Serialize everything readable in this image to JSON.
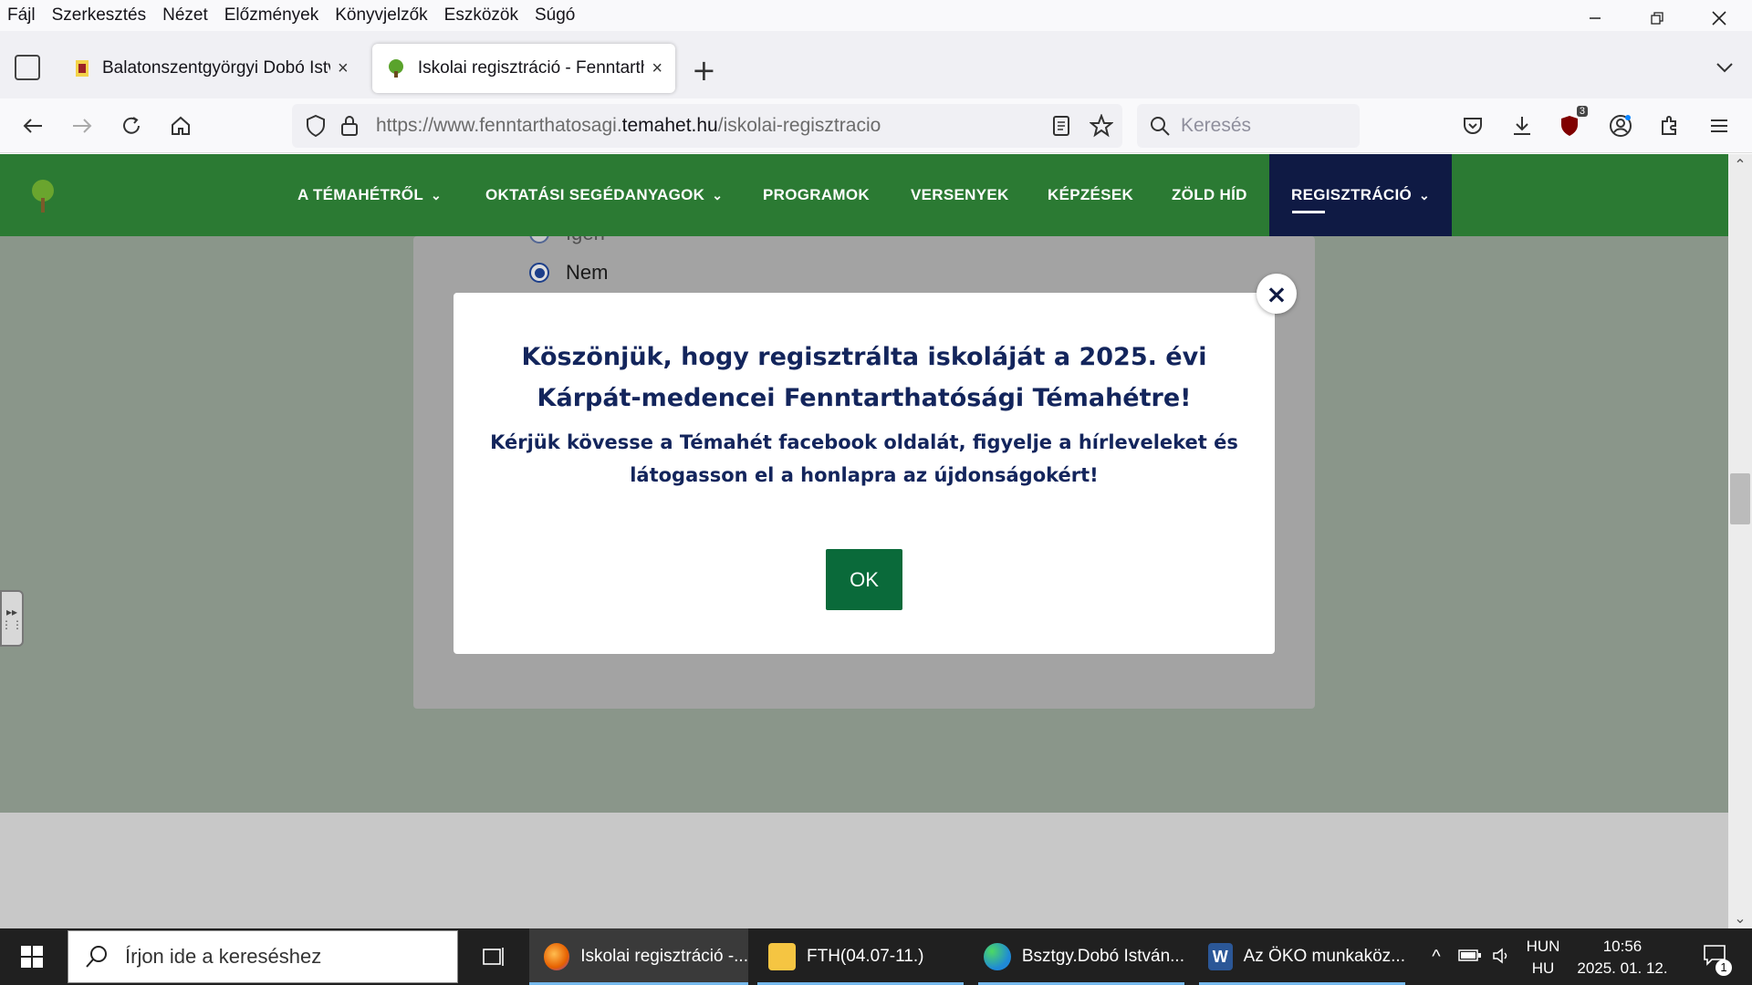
{
  "menu": [
    "Fájl",
    "Szerkesztés",
    "Nézet",
    "Előzmények",
    "Könyvjelzők",
    "Eszközök",
    "Súgó"
  ],
  "tabs": [
    {
      "title": "Balatonszentgyörgyi Dobó Istvá",
      "close": "×"
    },
    {
      "title": "Iskolai regisztráció - Fenntartha",
      "close": "×"
    }
  ],
  "newtab": "+",
  "url": {
    "prefix": "https://www.fenntarthatosagi.",
    "domain": "temahet.hu",
    "path": "/iskolai-regisztracio"
  },
  "search_placeholder": "Keresés",
  "extension_badge": "3",
  "site_nav": [
    {
      "label": "A TÉMAHÉTRŐL",
      "chevron": true
    },
    {
      "label": "OKTATÁSI SEGÉDANYAGOK",
      "chevron": true
    },
    {
      "label": "PROGRAMOK"
    },
    {
      "label": "VERSENYEK"
    },
    {
      "label": "KÉPZÉSEK"
    },
    {
      "label": "ZÖLD HÍD"
    },
    {
      "label": "REGISZTRÁCIÓ",
      "chevron": true,
      "active": true
    }
  ],
  "form": {
    "option_yes": "Igen",
    "option_no": "Nem",
    "selected": "Nem"
  },
  "modal": {
    "title": "Köszönjük, hogy regisztrálta iskoláját a 2025. évi Kárpát-medencei Fenntarthatósági Témahétre!",
    "text": "Kérjük kövesse a Témahét facebook oldalát, figyelje a hírleveleket és látogasson el a honlapra az újdonságokért!",
    "ok_label": "OK",
    "close": "×"
  },
  "taskbar": {
    "search_placeholder": "Írjon ide a kereséshez",
    "items": [
      {
        "label": "Iskolai regisztráció -...",
        "icon": "firefox-icon",
        "color": "#e66000"
      },
      {
        "label": "FTH(04.07-11.)",
        "icon": "folder-icon",
        "color": "#f5c542"
      },
      {
        "label": "Bsztgy.Dobó István...",
        "icon": "edge-icon",
        "color": "#1f8ad6"
      },
      {
        "label": "Az ÖKO munkaköz...",
        "icon": "word-icon",
        "color": "#2b5797"
      }
    ],
    "lang_top": "HUN",
    "lang_bottom": "HU",
    "time": "10:56",
    "date": "2025. 01. 12.",
    "notifications": "1"
  },
  "colors": {
    "site_green": "#2b7a33",
    "active_nav": "#0f1a44",
    "modal_text": "#13255c",
    "ok_button": "#0a6a3a"
  }
}
